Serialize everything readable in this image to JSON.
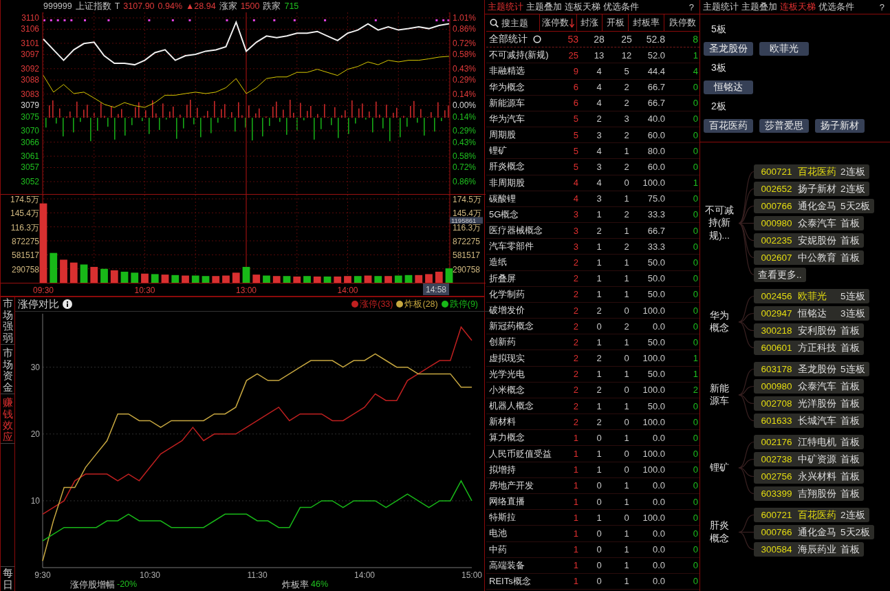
{
  "index_header": [
    {
      "text": "999999",
      "color": "#c0c0c0"
    },
    {
      "text": "上证指数",
      "color": "#c0c0c0"
    },
    {
      "text": "T",
      "color": "#c0c0c0"
    },
    {
      "text": "3107.90",
      "color": "#e03a3a"
    },
    {
      "text": "0.94%",
      "color": "#e03a3a"
    },
    {
      "text": "▲28.94",
      "color": "#e03a3a"
    },
    {
      "text": "涨家",
      "color": "#c0c0c0"
    },
    {
      "text": "1500",
      "color": "#e03a3a"
    },
    {
      "text": "跌家",
      "color": "#c0c0c0"
    },
    {
      "text": "715",
      "color": "#1fc01f"
    }
  ],
  "price_chart": {
    "percent_axis": [
      "1.01%",
      "0.86%",
      "0.72%",
      "0.58%",
      "0.43%",
      "0.29%",
      "0.14%",
      "0.00%",
      "0.14%",
      "0.29%",
      "0.43%",
      "0.58%",
      "0.72%",
      "0.86%"
    ],
    "chart_data": {
      "type": "line",
      "ylim": [
        3052,
        3110
      ],
      "grid": true,
      "yticks": [
        3110,
        3106,
        3101,
        3097,
        3092,
        3088,
        3083,
        3079,
        3075,
        3070,
        3066,
        3061,
        3057,
        3052
      ],
      "series": [
        {
          "color": "#f0f0f0",
          "values": [
            3102.5,
            3098.7,
            3095.0,
            3098.7,
            3100.9,
            3101.4,
            3096.6,
            3093.9,
            3093.9,
            3093.4,
            3095.0,
            3097.7,
            3098.7,
            3095.0,
            3096.6,
            3097.1,
            3098.2,
            3098.7,
            3099.8,
            3108.5,
            3098.2,
            3101.4,
            3103.6,
            3103.0,
            3103.6,
            3104.6,
            3104.6,
            3105.2,
            3103.6,
            3102.0,
            3104.6,
            3105.7,
            3107.9,
            3105.7,
            3106.8,
            3105.7,
            3106.2,
            3106.8,
            3106.2,
            3107.3,
            3107.9
          ]
        },
        {
          "color": "#d8c800",
          "values": [
            3089.6,
            3083.7,
            3086.4,
            3083.2,
            3083.7,
            3081.6,
            3079.4,
            3078.3,
            3080.0,
            3078.9,
            3078.3,
            3080.0,
            3082.6,
            3082.6,
            3083.2,
            3083.7,
            3083.2,
            3083.7,
            3085.3,
            3088.5,
            3083.2,
            3085.3,
            3088.5,
            3089.1,
            3089.1,
            3090.7,
            3090.7,
            3091.8,
            3090.7,
            3089.6,
            3091.8,
            3092.8,
            3094.4,
            3093.4,
            3095.0,
            3094.4,
            3095.0,
            3095.0,
            3095.5,
            3096.1,
            3096.4
          ]
        }
      ]
    }
  },
  "volume_chart": {
    "left_axis_upper": [
      "174.5万",
      "145.4万",
      "116.3万"
    ],
    "right_axis": [
      "174.5万",
      "145.4万",
      "116.3万",
      "872275",
      "581517",
      "290758"
    ],
    "chart_data": {
      "type": "bar",
      "ylim": [
        0,
        1745000
      ],
      "grid": true,
      "yticks": [
        872275,
        581517,
        290758
      ],
      "categories": [
        "09:30",
        null,
        null,
        null,
        null,
        null,
        null,
        null,
        null,
        null,
        "10:30",
        null,
        null,
        null,
        null,
        null,
        null,
        null,
        null,
        null,
        "13:00",
        null,
        null,
        null,
        null,
        null,
        null,
        null,
        null,
        null,
        "14:00",
        null,
        null,
        null,
        null,
        null,
        null,
        null,
        null,
        null,
        null
      ],
      "series": [
        {
          "color": "#d83030",
          "values": [
            1650000,
            null,
            480000,
            420000,
            null,
            330000,
            null,
            260000,
            null,
            null,
            190000,
            null,
            170000,
            null,
            150000,
            null,
            null,
            140000,
            150000,
            210000,
            null,
            170000,
            null,
            140000,
            null,
            130000,
            null,
            130000,
            null,
            130000,
            140000,
            null,
            150000,
            null,
            140000,
            null,
            null,
            160000,
            180000,
            230000,
            null
          ]
        },
        {
          "color": "#18b818",
          "values": [
            null,
            620000,
            null,
            null,
            380000,
            null,
            290000,
            null,
            230000,
            210000,
            null,
            180000,
            null,
            160000,
            null,
            150000,
            140000,
            null,
            null,
            null,
            330000,
            null,
            150000,
            null,
            140000,
            null,
            140000,
            null,
            130000,
            null,
            null,
            140000,
            null,
            140000,
            null,
            150000,
            160000,
            null,
            null,
            null,
            300000
          ]
        }
      ]
    }
  },
  "crosshair": {
    "value": "1195861",
    "time": "14:58"
  },
  "side_tabs": [
    {
      "label": "市场强弱",
      "selected": false
    },
    {
      "label": "市场资金",
      "selected": false
    },
    {
      "label": "赚钱效应",
      "selected": true
    }
  ],
  "daily_tab": {
    "label": "每日",
    "selected": false
  },
  "bottom_chart": {
    "title": "涨停对比",
    "chart_data": {
      "type": "line",
      "ylim": [
        0,
        38
      ],
      "grid": true,
      "yticks": [
        10,
        20,
        30
      ],
      "categories": [
        "9:30",
        null,
        null,
        null,
        null,
        null,
        null,
        null,
        null,
        null,
        "10:30",
        null,
        null,
        null,
        null,
        null,
        null,
        null,
        null,
        null,
        "11:30",
        null,
        null,
        null,
        null,
        null,
        null,
        null,
        null,
        null,
        "14:00",
        null,
        null,
        null,
        null,
        null,
        null,
        null,
        null,
        null,
        "15:00"
      ],
      "series": [
        {
          "name": "涨停(33)",
          "color": "#c02020",
          "values": [
            8,
            9,
            10,
            13,
            14,
            14,
            14,
            13,
            14,
            13,
            15,
            17,
            18,
            19,
            21,
            19,
            20,
            20,
            20,
            21,
            22,
            23,
            24,
            22,
            23,
            23,
            23,
            22,
            22,
            23,
            24,
            26,
            25,
            25,
            28,
            29,
            30,
            31,
            31,
            36,
            34
          ]
        },
        {
          "name": "炸板(28)",
          "color": "#c8a840",
          "values": [
            1,
            7,
            12,
            12,
            15,
            17,
            19,
            23,
            23,
            22,
            22,
            21,
            22,
            22,
            22,
            22,
            23,
            23,
            24,
            28,
            29,
            28,
            28,
            29,
            30,
            31,
            31,
            31,
            30,
            31,
            31,
            32,
            31,
            30,
            30,
            29,
            29,
            29,
            29,
            27,
            27
          ]
        },
        {
          "name": "跌停(9)",
          "color": "#18b818",
          "values": [
            4,
            5,
            6,
            6,
            6,
            6,
            7,
            7,
            8,
            7,
            7,
            7,
            6,
            6,
            6,
            6,
            7,
            8,
            8,
            8,
            7,
            7,
            6,
            6,
            9,
            9,
            10,
            10,
            9,
            10,
            10,
            10,
            9,
            10,
            11,
            10,
            9,
            10,
            10,
            13,
            10
          ]
        }
      ]
    },
    "stats": [
      {
        "label": "涨停股增幅",
        "value": "-20%"
      },
      {
        "label": "炸板率",
        "value": "46%"
      }
    ]
  },
  "theme_table": {
    "tabs": [
      {
        "label": "主题统计",
        "selected": true
      },
      {
        "label": "主题叠加",
        "selected": false
      },
      {
        "label": "连板天梯",
        "selected": false
      },
      {
        "label": "优选条件",
        "selected": false
      }
    ],
    "help": "?",
    "search": {
      "placeholder": "搜主题"
    },
    "columns": [
      {
        "label": "涨停数",
        "sorted": true
      },
      {
        "label": "封涨",
        "sorted": false
      },
      {
        "label": "开板",
        "sorted": false
      },
      {
        "label": "封板率",
        "sorted": false
      },
      {
        "label": "跌停数",
        "sorted": false
      }
    ],
    "rows": [
      {
        "kind": "total",
        "name": "全部统计",
        "limit_up": "53",
        "sealed": "28",
        "opened": "25",
        "seal_rate": "52.8",
        "limit_down": "8"
      },
      {
        "kind": "theme",
        "name": "不可减持(新规)",
        "limit_up": "25",
        "sealed": "13",
        "opened": "12",
        "seal_rate": "52.0",
        "limit_down": "1"
      },
      {
        "kind": "theme",
        "name": "非融精选",
        "limit_up": "9",
        "sealed": "4",
        "opened": "5",
        "seal_rate": "44.4",
        "limit_down": "4"
      },
      {
        "kind": "theme",
        "name": "华为概念",
        "limit_up": "6",
        "sealed": "4",
        "opened": "2",
        "seal_rate": "66.7",
        "limit_down": "0"
      },
      {
        "kind": "theme",
        "name": "新能源车",
        "limit_up": "6",
        "sealed": "4",
        "opened": "2",
        "seal_rate": "66.7",
        "limit_down": "0"
      },
      {
        "kind": "theme",
        "name": "华为汽车",
        "limit_up": "5",
        "sealed": "2",
        "opened": "3",
        "seal_rate": "40.0",
        "limit_down": "0"
      },
      {
        "kind": "theme",
        "name": "周期股",
        "limit_up": "5",
        "sealed": "3",
        "opened": "2",
        "seal_rate": "60.0",
        "limit_down": "0"
      },
      {
        "kind": "theme",
        "name": "锂矿",
        "limit_up": "5",
        "sealed": "4",
        "opened": "1",
        "seal_rate": "80.0",
        "limit_down": "0"
      },
      {
        "kind": "theme",
        "name": "肝炎概念",
        "limit_up": "5",
        "sealed": "3",
        "opened": "2",
        "seal_rate": "60.0",
        "limit_down": "0"
      },
      {
        "kind": "theme",
        "name": "非周期股",
        "limit_up": "4",
        "sealed": "4",
        "opened": "0",
        "seal_rate": "100.0",
        "limit_down": "1"
      },
      {
        "kind": "theme",
        "name": "碳酸锂",
        "limit_up": "4",
        "sealed": "3",
        "opened": "1",
        "seal_rate": "75.0",
        "limit_down": "0"
      },
      {
        "kind": "theme",
        "name": "5G概念",
        "limit_up": "3",
        "sealed": "1",
        "opened": "2",
        "seal_rate": "33.3",
        "limit_down": "0"
      },
      {
        "kind": "theme",
        "name": "医疗器械概念",
        "limit_up": "3",
        "sealed": "2",
        "opened": "1",
        "seal_rate": "66.7",
        "limit_down": "0"
      },
      {
        "kind": "theme",
        "name": "汽车零部件",
        "limit_up": "3",
        "sealed": "1",
        "opened": "2",
        "seal_rate": "33.3",
        "limit_down": "0"
      },
      {
        "kind": "theme",
        "name": "造纸",
        "limit_up": "2",
        "sealed": "1",
        "opened": "1",
        "seal_rate": "50.0",
        "limit_down": "0"
      },
      {
        "kind": "theme",
        "name": "折叠屏",
        "limit_up": "2",
        "sealed": "1",
        "opened": "1",
        "seal_rate": "50.0",
        "limit_down": "0"
      },
      {
        "kind": "theme",
        "name": "化学制药",
        "limit_up": "2",
        "sealed": "1",
        "opened": "1",
        "seal_rate": "50.0",
        "limit_down": "0"
      },
      {
        "kind": "theme",
        "name": "破增发价",
        "limit_up": "2",
        "sealed": "2",
        "opened": "0",
        "seal_rate": "100.0",
        "limit_down": "0"
      },
      {
        "kind": "theme",
        "name": "新冠药概念",
        "limit_up": "2",
        "sealed": "0",
        "opened": "2",
        "seal_rate": "0.0",
        "limit_down": "0"
      },
      {
        "kind": "theme",
        "name": "创新药",
        "limit_up": "2",
        "sealed": "1",
        "opened": "1",
        "seal_rate": "50.0",
        "limit_down": "0"
      },
      {
        "kind": "theme",
        "name": "虚拟现实",
        "limit_up": "2",
        "sealed": "2",
        "opened": "0",
        "seal_rate": "100.0",
        "limit_down": "1"
      },
      {
        "kind": "theme",
        "name": "光学光电",
        "limit_up": "2",
        "sealed": "1",
        "opened": "1",
        "seal_rate": "50.0",
        "limit_down": "1"
      },
      {
        "kind": "theme",
        "name": "小米概念",
        "limit_up": "2",
        "sealed": "2",
        "opened": "0",
        "seal_rate": "100.0",
        "limit_down": "2"
      },
      {
        "kind": "theme",
        "name": "机器人概念",
        "limit_up": "2",
        "sealed": "1",
        "opened": "1",
        "seal_rate": "50.0",
        "limit_down": "0"
      },
      {
        "kind": "theme",
        "name": "新材料",
        "limit_up": "2",
        "sealed": "2",
        "opened": "0",
        "seal_rate": "100.0",
        "limit_down": "0"
      },
      {
        "kind": "theme",
        "name": "算力概念",
        "limit_up": "1",
        "sealed": "0",
        "opened": "1",
        "seal_rate": "0.0",
        "limit_down": "0"
      },
      {
        "kind": "theme",
        "name": "人民币贬值受益",
        "limit_up": "1",
        "sealed": "1",
        "opened": "0",
        "seal_rate": "100.0",
        "limit_down": "0"
      },
      {
        "kind": "theme",
        "name": "拟增持",
        "limit_up": "1",
        "sealed": "1",
        "opened": "0",
        "seal_rate": "100.0",
        "limit_down": "0"
      },
      {
        "kind": "theme",
        "name": "房地产开发",
        "limit_up": "1",
        "sealed": "0",
        "opened": "1",
        "seal_rate": "0.0",
        "limit_down": "0"
      },
      {
        "kind": "theme",
        "name": "网络直播",
        "limit_up": "1",
        "sealed": "0",
        "opened": "1",
        "seal_rate": "0.0",
        "limit_down": "0"
      },
      {
        "kind": "theme",
        "name": "特斯拉",
        "limit_up": "1",
        "sealed": "1",
        "opened": "0",
        "seal_rate": "100.0",
        "limit_down": "0"
      },
      {
        "kind": "theme",
        "name": "电池",
        "limit_up": "1",
        "sealed": "0",
        "opened": "1",
        "seal_rate": "0.0",
        "limit_down": "0"
      },
      {
        "kind": "theme",
        "name": "中药",
        "limit_up": "1",
        "sealed": "0",
        "opened": "1",
        "seal_rate": "0.0",
        "limit_down": "0"
      },
      {
        "kind": "theme",
        "name": "高端装备",
        "limit_up": "1",
        "sealed": "0",
        "opened": "1",
        "seal_rate": "0.0",
        "limit_down": "0"
      },
      {
        "kind": "theme",
        "name": "REITs概念",
        "limit_up": "1",
        "sealed": "0",
        "opened": "1",
        "seal_rate": "0.0",
        "limit_down": "0"
      }
    ]
  },
  "ladder_panel": {
    "tabs": [
      {
        "label": "主题统计",
        "selected": false
      },
      {
        "label": "主题叠加",
        "selected": false
      },
      {
        "label": "连板天梯",
        "selected": true
      },
      {
        "label": "优选条件",
        "selected": false
      }
    ],
    "help": "?",
    "levels": [
      {
        "label": "5板",
        "stocks": [
          "圣龙股份",
          "欧菲光"
        ]
      },
      {
        "label": "3板",
        "stocks": [
          "恒铭达"
        ]
      },
      {
        "label": "2板",
        "stocks": [
          "百花医药",
          "莎普爱思",
          "扬子新材"
        ]
      }
    ],
    "themes": [
      {
        "label": "不可减持(新规)...",
        "more": "查看更多..",
        "stocks": [
          {
            "code": "600721",
            "name": "百花医药",
            "tag": "2连板",
            "highlighted": true
          },
          {
            "code": "002652",
            "name": "扬子新材",
            "tag": "2连板",
            "highlighted": false
          },
          {
            "code": "000766",
            "name": "通化金马",
            "tag": "5天2板",
            "highlighted": false
          },
          {
            "code": "000980",
            "name": "众泰汽车",
            "tag": "首板",
            "highlighted": false
          },
          {
            "code": "002235",
            "name": "安妮股份",
            "tag": "首板",
            "highlighted": false
          },
          {
            "code": "002607",
            "name": "中公教育",
            "tag": "首板",
            "highlighted": false
          }
        ]
      },
      {
        "label": "华为概念",
        "stocks": [
          {
            "code": "002456",
            "name": "欧菲光",
            "tag": "5连板",
            "highlighted": true
          },
          {
            "code": "002947",
            "name": "恒铭达",
            "tag": "3连板",
            "highlighted": false
          },
          {
            "code": "300218",
            "name": "安利股份",
            "tag": "首板",
            "highlighted": false
          },
          {
            "code": "600601",
            "name": "方正科技",
            "tag": "首板",
            "highlighted": false
          }
        ]
      },
      {
        "label": "新能源车",
        "stocks": [
          {
            "code": "603178",
            "name": "圣龙股份",
            "tag": "5连板",
            "highlighted": false
          },
          {
            "code": "000980",
            "name": "众泰汽车",
            "tag": "首板",
            "highlighted": false
          },
          {
            "code": "002708",
            "name": "光洋股份",
            "tag": "首板",
            "highlighted": false
          },
          {
            "code": "601633",
            "name": "长城汽车",
            "tag": "首板",
            "highlighted": false
          }
        ]
      },
      {
        "label": "锂矿",
        "stocks": [
          {
            "code": "002176",
            "name": "江特电机",
            "tag": "首板",
            "highlighted": false
          },
          {
            "code": "002738",
            "name": "中矿资源",
            "tag": "首板",
            "highlighted": false
          },
          {
            "code": "002756",
            "name": "永兴材料",
            "tag": "首板",
            "highlighted": false
          },
          {
            "code": "603399",
            "name": "吉翔股份",
            "tag": "首板",
            "highlighted": false
          }
        ]
      },
      {
        "label": "肝炎概念",
        "stocks": [
          {
            "code": "600721",
            "name": "百花医药",
            "tag": "2连板",
            "highlighted": true
          },
          {
            "code": "000766",
            "name": "通化金马",
            "tag": "5天2板",
            "highlighted": false
          },
          {
            "code": "300584",
            "name": "海辰药业",
            "tag": "首板",
            "highlighted": false
          }
        ]
      }
    ]
  }
}
